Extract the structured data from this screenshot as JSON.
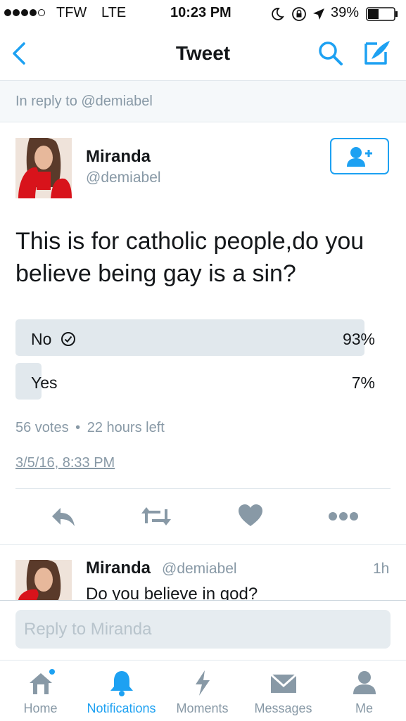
{
  "status_bar": {
    "carrier": "TFW",
    "network": "LTE",
    "time": "10:23 PM",
    "battery": "39%"
  },
  "nav": {
    "title": "Tweet"
  },
  "reply_context": "In reply to @demiabel",
  "tweet": {
    "name": "Miranda",
    "handle": "@demiabel",
    "text": "This is for catholic people,do you believe being gay is a sin?",
    "poll": {
      "options": [
        {
          "label": "No",
          "percent_text": "93%",
          "percent": 93,
          "selected": true
        },
        {
          "label": "Yes",
          "percent_text": "7%",
          "percent": 7,
          "selected": false
        }
      ],
      "votes": "56 votes",
      "time_left": "22 hours left"
    },
    "timestamp": "3/5/16, 8:33 PM"
  },
  "reply": {
    "name": "Miranda",
    "handle": "@demiabel",
    "age": "1h",
    "text": "Do you believe in god?"
  },
  "composer": {
    "placeholder": "Reply to Miranda"
  },
  "tabs": [
    {
      "label": "Home",
      "icon": "home-icon"
    },
    {
      "label": "Notifications",
      "icon": "bell-icon"
    },
    {
      "label": "Moments",
      "icon": "lightning-icon"
    },
    {
      "label": "Messages",
      "icon": "envelope-icon"
    },
    {
      "label": "Me",
      "icon": "person-icon"
    }
  ],
  "active_tab": "Notifications",
  "colors": {
    "accent": "#1da1f2",
    "muted": "#8899a6",
    "poll_bar": "#e1e8ed"
  }
}
